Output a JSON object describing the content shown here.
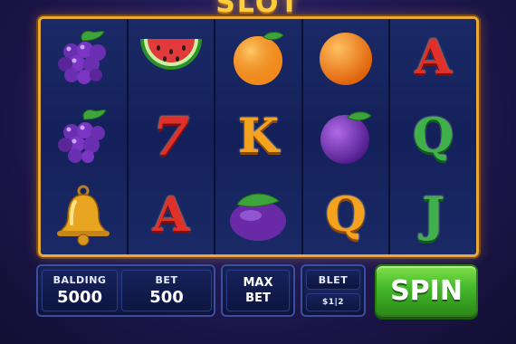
{
  "game": {
    "title": "SLOT"
  },
  "reels": [
    [
      "grapes-icon",
      "grapes-icon",
      "bell-icon"
    ],
    [
      "watermelon-icon",
      "7",
      "A"
    ],
    [
      "orange-icon",
      "K",
      "plum-icon"
    ],
    [
      "orange-icon",
      "plum-icon",
      "Q"
    ],
    [
      "A",
      "Q",
      "J"
    ]
  ],
  "symbol_text": {
    "seven": "7",
    "a1": "A",
    "k": "K",
    "q1": "Q",
    "a2": "A",
    "q2": "Q",
    "j": "J"
  },
  "controls": {
    "balance_label": "BALDING",
    "balance_value": "5000",
    "bet_label": "BET",
    "bet_value": "500",
    "max_bet_line1": "MAX",
    "max_bet_line2": "BET",
    "blet_label": "BLET",
    "blet_value": "$1|2",
    "spin_label": "SPIN"
  },
  "colors": {
    "frame": "#e9a83a",
    "spin": "#44b82a",
    "background": "#211a55"
  }
}
